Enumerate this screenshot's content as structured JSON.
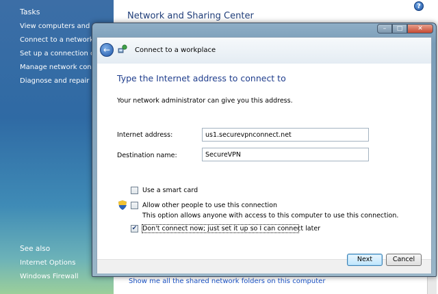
{
  "background_window": {
    "title": "Network and Sharing Center",
    "sidebar": {
      "tasks_title": "Tasks",
      "tasks": [
        "View computers and devices",
        "Connect to a network",
        "Set up a connection or network",
        "Manage network connections",
        "Diagnose and repair"
      ],
      "see_also_title": "See also",
      "see_also": [
        "Internet Options",
        "Windows Firewall"
      ]
    },
    "bottom_link": "Show me all the shared network folders on this computer",
    "help_glyph": "?"
  },
  "dialog": {
    "wizard_title": "Connect to a workplace",
    "main_instruction": "Type the Internet address to connect to",
    "description": "Your network administrator can give you this address.",
    "fields": {
      "internet_address": {
        "label": "Internet address:",
        "value": "us1.securevpnconnect.net"
      },
      "destination_name": {
        "label": "Destination name:",
        "value": "SecureVPN"
      }
    },
    "options": {
      "smart_card": {
        "label": "Use a smart card",
        "checked": false
      },
      "allow_others": {
        "label": "Allow other people to use this connection",
        "hint": "This option allows anyone with access to this computer to use this connection.",
        "checked": false
      },
      "dont_connect": {
        "label": "Don't connect now; just set it up so I can connect later",
        "checked": true
      }
    },
    "buttons": {
      "next": "Next",
      "cancel": "Cancel"
    },
    "titlebar": {
      "minimize": "–",
      "maximize": "□",
      "close": "✕"
    }
  },
  "colors": {
    "instruction": "#1e3c8c",
    "link": "#1a52c6",
    "sidebar": "#2f6aa4"
  },
  "icons": [
    "help-icon",
    "back-arrow-icon",
    "network-wizard-icon",
    "uac-shield-icon",
    "checkmark-icon"
  ]
}
